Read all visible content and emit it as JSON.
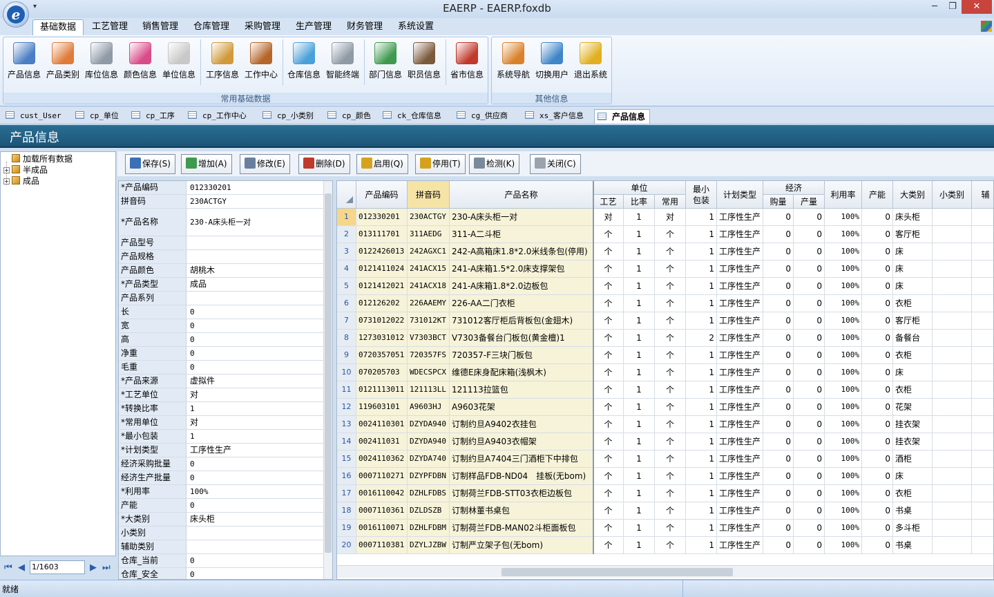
{
  "window": {
    "title": "EAERP - EAERP.foxdb",
    "logo_letter": "e",
    "qat": "▾",
    "min": "─",
    "restore": "❐",
    "close": "✕"
  },
  "menu": {
    "tabs": [
      "基础数据",
      "工艺管理",
      "销售管理",
      "仓库管理",
      "采购管理",
      "生产管理",
      "财务管理",
      "系统设置"
    ],
    "active": 0
  },
  "ribbon": {
    "groups": [
      {
        "caption": "常用基础数据"
      },
      {
        "caption": "其他信息"
      }
    ],
    "buttons": [
      {
        "label": "产品信息",
        "icon": "product-icon",
        "color": "#4b7fc4"
      },
      {
        "label": "产品类别",
        "icon": "category-icon",
        "color": "#e07b39"
      },
      {
        "label": "库位信息",
        "icon": "cart-icon",
        "color": "#8f9aa6"
      },
      {
        "label": "颜色信息",
        "icon": "palette-icon",
        "color": "#d94c8a"
      },
      {
        "label": "单位信息",
        "icon": "unit-icon",
        "color": "#c8c8c8"
      },
      {
        "label": "工序信息",
        "icon": "process-icon",
        "color": "#d09a3a"
      },
      {
        "label": "工作中心",
        "icon": "hammer-icon",
        "color": "#b5652a"
      },
      {
        "label": "仓库信息",
        "icon": "warehouse-icon",
        "color": "#4aa0d8"
      },
      {
        "label": "智能终端",
        "icon": "terminal-icon",
        "color": "#8f9aa6"
      },
      {
        "label": "部门信息",
        "icon": "department-icon",
        "color": "#3f9a4f"
      },
      {
        "label": "职员信息",
        "icon": "staff-icon",
        "color": "#7a5a3c"
      },
      {
        "label": "省市信息",
        "icon": "map-icon",
        "color": "#c0392b"
      },
      {
        "label": "系统导航",
        "icon": "signpost-icon",
        "color": "#d9822b"
      },
      {
        "label": "切换用户",
        "icon": "switch-user-icon",
        "color": "#3f86c8"
      },
      {
        "label": "退出系统",
        "icon": "exit-icon",
        "color": "#e0b020"
      }
    ]
  },
  "doc_tabs": [
    "cust_User",
    "cp_单位",
    "cp_工序",
    "cp_工作中心",
    "cp_小类别",
    "cp_颜色",
    "ck_仓库信息",
    "cg_供应商",
    "xs_客户信息",
    "产品信息"
  ],
  "page": {
    "title": "产品信息"
  },
  "tree": {
    "nodes": [
      {
        "label": "加载所有数据",
        "exp": ""
      },
      {
        "label": "半成品",
        "exp": "+"
      },
      {
        "label": "成品",
        "exp": "+"
      }
    ]
  },
  "pager": {
    "value": "1/1603",
    "first": "⏮",
    "prev": "◀",
    "next": "▶",
    "last": "⏭"
  },
  "toolbar": [
    {
      "label": "保存(S)",
      "color": "#3b6fb6"
    },
    {
      "label": "增加(A)",
      "color": "#3f9a4f"
    },
    {
      "label": "修改(E)",
      "color": "#6a7fa0"
    },
    {
      "label": "删除(D)",
      "color": "#c0392b"
    },
    {
      "label": "启用(Q)",
      "color": "#d6a21e"
    },
    {
      "label": "停用(T)",
      "color": "#d6a21e"
    },
    {
      "label": "检测(K)",
      "color": "#7a8a9a"
    },
    {
      "label": "关闭(C)",
      "color": "#9aa3ad"
    }
  ],
  "props": [
    [
      "*产品编码",
      "012330201"
    ],
    [
      "拼音码",
      "230ACTGY"
    ],
    [
      "*产品名称",
      "230-A床头柜一对"
    ],
    [
      "产品型号",
      ""
    ],
    [
      "产品规格",
      ""
    ],
    [
      "产品颜色",
      "胡桃木"
    ],
    [
      "*产品类型",
      "成品"
    ],
    [
      "产品系列",
      ""
    ],
    [
      "长",
      "0"
    ],
    [
      "宽",
      "0"
    ],
    [
      "高",
      "0"
    ],
    [
      "净重",
      "0"
    ],
    [
      "毛重",
      "0"
    ],
    [
      "*产品来源",
      "虚拟件"
    ],
    [
      "*工艺单位",
      "对"
    ],
    [
      "*转换比率",
      "1"
    ],
    [
      "*常用单位",
      "对"
    ],
    [
      "*最小包装",
      "1"
    ],
    [
      "*计划类型",
      "工序性生产"
    ],
    [
      "经济采购批量",
      "0"
    ],
    [
      "经济生产批量",
      "0"
    ],
    [
      "*利用率",
      "100%"
    ],
    [
      "产能",
      "0"
    ],
    [
      "*大类别",
      "床头柜"
    ],
    [
      "小类别",
      ""
    ],
    [
      "辅助类别",
      ""
    ],
    [
      "仓库_当前",
      "0"
    ],
    [
      "仓库_安全",
      "0"
    ]
  ],
  "grid": {
    "headers": {
      "code": "产品编码",
      "pinyin": "拼音码",
      "name": "产品名称",
      "unit": "单位",
      "craft": "工艺",
      "ratio": "比率",
      "common": "常用",
      "minpack": "最小\n包装",
      "plan": "计划类型",
      "econ": "经济",
      "buy": "购量",
      "prod": "产量",
      "util": "利用率",
      "cap": "产能",
      "big": "大类别",
      "small": "小类别",
      "aux": "辅"
    },
    "rows": [
      [
        "012330201",
        "230ACTGY",
        "230-A床头柜一对",
        "对",
        "1",
        "对",
        "1",
        "工序性生产",
        "0",
        "0",
        "100%",
        "0",
        "床头柜",
        ""
      ],
      [
        "013111701",
        "311AEDG",
        "311-A二斗柜",
        "个",
        "1",
        "个",
        "1",
        "工序性生产",
        "0",
        "0",
        "100%",
        "0",
        "客厅柜",
        ""
      ],
      [
        "0122426013",
        "242AGXC1",
        "242-A高箱床1.8*2.0米线条包(停用)",
        "个",
        "1",
        "个",
        "1",
        "工序性生产",
        "0",
        "0",
        "100%",
        "0",
        "床",
        ""
      ],
      [
        "0121411024",
        "241ACX15",
        "241-A床箱1.5*2.0床支撑架包",
        "个",
        "1",
        "个",
        "1",
        "工序性生产",
        "0",
        "0",
        "100%",
        "0",
        "床",
        ""
      ],
      [
        "0121412021",
        "241ACX18",
        "241-A床箱1.8*2.0边板包",
        "个",
        "1",
        "个",
        "1",
        "工序性生产",
        "0",
        "0",
        "100%",
        "0",
        "床",
        ""
      ],
      [
        "012126202",
        "226AAEMY",
        "226-AA二门衣柜",
        "个",
        "1",
        "个",
        "1",
        "工序性生产",
        "0",
        "0",
        "100%",
        "0",
        "衣柜",
        ""
      ],
      [
        "0731012022",
        "731012KT",
        "731012客厅柜后背板包(金翅木)",
        "个",
        "1",
        "个",
        "1",
        "工序性生产",
        "0",
        "0",
        "100%",
        "0",
        "客厅柜",
        ""
      ],
      [
        "1273031012",
        "V7303BCT",
        "V7303备餐台门板包(黄金檀)1",
        "个",
        "1",
        "个",
        "2",
        "工序性生产",
        "0",
        "0",
        "100%",
        "0",
        "备餐台",
        ""
      ],
      [
        "0720357051",
        "720357FS",
        "720357-F三块门板包",
        "个",
        "1",
        "个",
        "1",
        "工序性生产",
        "0",
        "0",
        "100%",
        "0",
        "衣柜",
        ""
      ],
      [
        "070205703",
        "WDECSPCX",
        "维德E床身配床箱(浅枫木)",
        "个",
        "1",
        "个",
        "1",
        "工序性生产",
        "0",
        "0",
        "100%",
        "0",
        "床",
        ""
      ],
      [
        "0121113011",
        "121113LL",
        "121113拉篮包",
        "个",
        "1",
        "个",
        "1",
        "工序性生产",
        "0",
        "0",
        "100%",
        "0",
        "衣柜",
        ""
      ],
      [
        "119603101",
        "A9603HJ",
        "A9603花架",
        "个",
        "1",
        "个",
        "1",
        "工序性生产",
        "0",
        "0",
        "100%",
        "0",
        "花架",
        ""
      ],
      [
        "0024110301",
        "DZYDA940",
        "订制约旦A9402衣挂包",
        "个",
        "1",
        "个",
        "1",
        "工序性生产",
        "0",
        "0",
        "100%",
        "0",
        "挂衣架",
        ""
      ],
      [
        "002411031",
        "DZYDA940",
        "订制约旦A9403衣帽架",
        "个",
        "1",
        "个",
        "1",
        "工序性生产",
        "0",
        "0",
        "100%",
        "0",
        "挂衣架",
        ""
      ],
      [
        "0024110362",
        "DZYDA740",
        "订制约旦A7404三门酒柜下中排包",
        "个",
        "1",
        "个",
        "1",
        "工序性生产",
        "0",
        "0",
        "100%",
        "0",
        "酒柜",
        ""
      ],
      [
        "0007110271",
        "DZYPFDBN",
        "订制样品FDB-ND04　挂板(无bom)",
        "个",
        "1",
        "个",
        "1",
        "工序性生产",
        "0",
        "0",
        "100%",
        "0",
        "床",
        ""
      ],
      [
        "0016110042",
        "DZHLFDBS",
        "订制荷兰FDB-STT03衣柜边板包",
        "个",
        "1",
        "个",
        "1",
        "工序性生产",
        "0",
        "0",
        "100%",
        "0",
        "衣柜",
        ""
      ],
      [
        "0007110361",
        "DZLDSZB",
        "订制林董书桌包",
        "个",
        "1",
        "个",
        "1",
        "工序性生产",
        "0",
        "0",
        "100%",
        "0",
        "书桌",
        ""
      ],
      [
        "0016110071",
        "DZHLFDBM",
        "订制荷兰FDB-MAN02斗柜面板包",
        "个",
        "1",
        "个",
        "1",
        "工序性生产",
        "0",
        "0",
        "100%",
        "0",
        "多斗柜",
        ""
      ],
      [
        "0007110381",
        "DZYLJZBW",
        "订制严立架子包(无bom)",
        "个",
        "1",
        "个",
        "1",
        "工序性生产",
        "0",
        "0",
        "100%",
        "0",
        "书桌",
        ""
      ]
    ]
  },
  "status": {
    "text": "就绪"
  }
}
